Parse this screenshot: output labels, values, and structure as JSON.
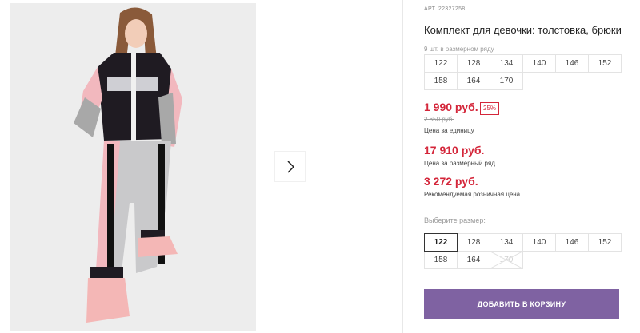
{
  "gallery": {
    "next_icon": "chevron-right-icon"
  },
  "product": {
    "sku": "АРТ. 22327258",
    "title": "Комплект для девочки: толстовка, брюки",
    "pack_note": "9 шт. в размерном ряду",
    "pack_sizes": [
      "122",
      "128",
      "134",
      "140",
      "146",
      "152",
      "158",
      "164",
      "170"
    ],
    "price": "1 990 руб.",
    "discount": "25%",
    "old_price": "2 650 руб.",
    "unit_price_label": "Цена за единицу",
    "pack_price": "17 910 руб.",
    "pack_price_label": "Цена за размерный ряд",
    "retail_price": "3 272 руб.",
    "retail_price_label": "Рекомендуемая розничная цена",
    "choose_size_label": "Выберите размер:",
    "sizes": [
      {
        "label": "122",
        "state": "selected"
      },
      {
        "label": "128",
        "state": "available"
      },
      {
        "label": "134",
        "state": "available"
      },
      {
        "label": "140",
        "state": "available"
      },
      {
        "label": "146",
        "state": "available"
      },
      {
        "label": "152",
        "state": "available"
      },
      {
        "label": "158",
        "state": "available"
      },
      {
        "label": "164",
        "state": "available"
      },
      {
        "label": "170",
        "state": "unavailable"
      }
    ],
    "add_to_cart": "ДОБАВИТЬ В КОРЗИНУ"
  },
  "colors": {
    "price_red": "#d4263a",
    "button_purple": "#7f62a2"
  }
}
